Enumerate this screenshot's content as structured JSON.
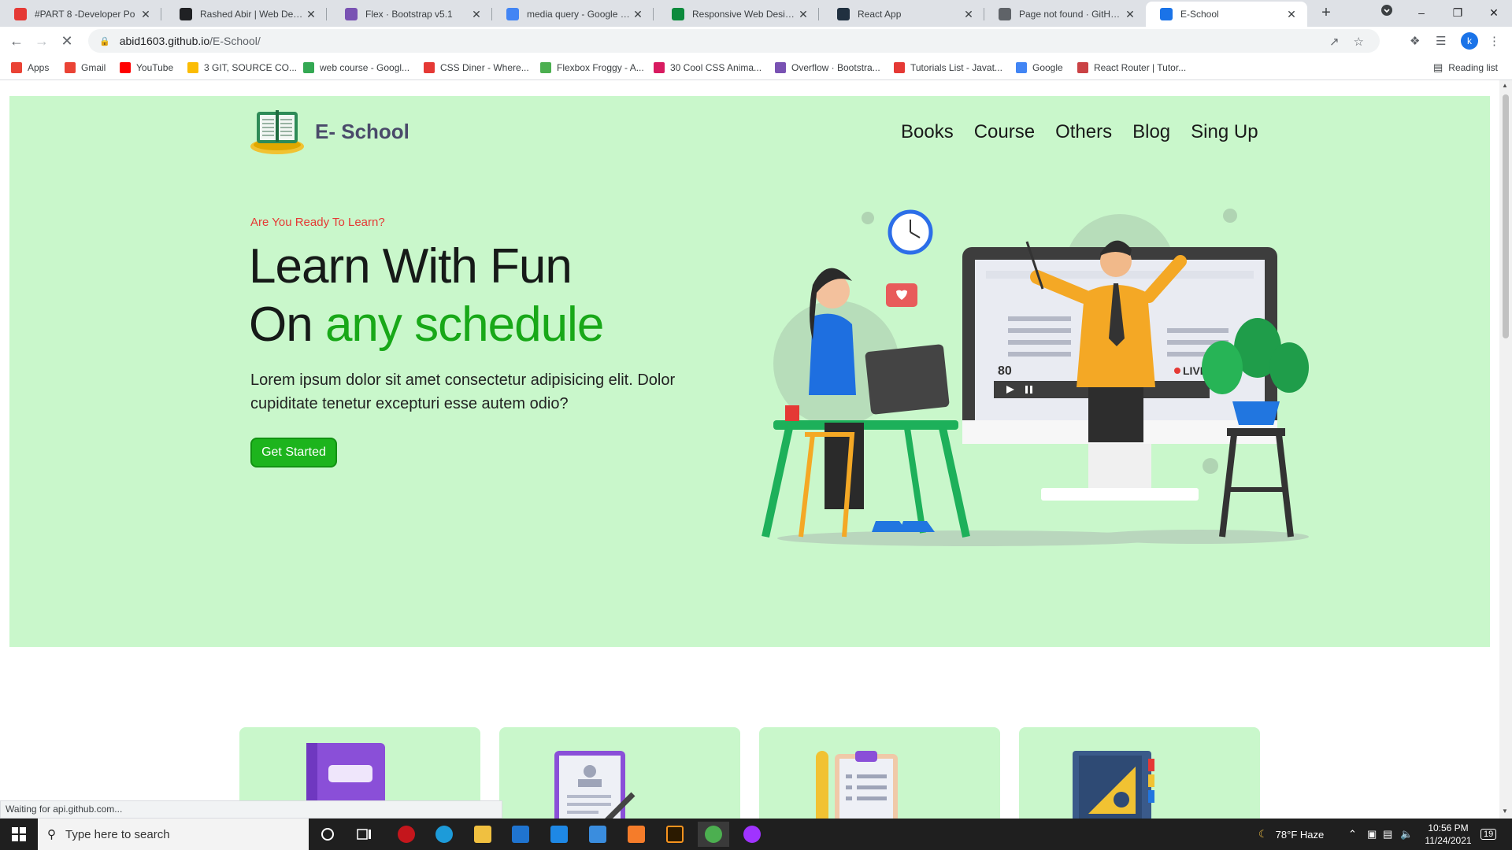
{
  "browser": {
    "tabs": [
      {
        "title": "#PART 8 -Developer Po",
        "icon": "youtube-icon",
        "color": "#e53935"
      },
      {
        "title": "Rashed Abir | Web Develop",
        "icon": "site-icon",
        "color": "#202124"
      },
      {
        "title": "Flex · Bootstrap v5.1",
        "icon": "bootstrap-icon",
        "color": "#7952b3"
      },
      {
        "title": "media query - Google Sear",
        "icon": "google-icon",
        "color": "#4285f4"
      },
      {
        "title": "Responsive Web Design M",
        "icon": "w-icon",
        "color": "#0c8a3c"
      },
      {
        "title": "React App",
        "icon": "react-icon",
        "color": "#203040"
      },
      {
        "title": "Page not found · GitHub P",
        "icon": "globe-icon",
        "color": "#5f6368"
      },
      {
        "title": "E-School",
        "icon": "loading-icon",
        "color": "#1a73e8"
      }
    ],
    "new_tab": "+",
    "url_host": "abid1603.github.io",
    "url_path": "/E-School/",
    "bookmarks": [
      {
        "label": "Apps",
        "color": "#ea4335"
      },
      {
        "label": "Gmail",
        "color": "#ea4335"
      },
      {
        "label": "YouTube",
        "color": "#ff0000"
      },
      {
        "label": "3 GIT, SOURCE CO...",
        "color": "#fbbc04"
      },
      {
        "label": "web course - Googl...",
        "color": "#34a853"
      },
      {
        "label": "CSS Diner - Where...",
        "color": "#e53935"
      },
      {
        "label": "Flexbox Froggy - A...",
        "color": "#4caf50"
      },
      {
        "label": "30 Cool CSS Anima...",
        "color": "#d81b60"
      },
      {
        "label": "Overflow · Bootstra...",
        "color": "#7952b3"
      },
      {
        "label": "Tutorials List - Javat...",
        "color": "#e53935"
      },
      {
        "label": "Google",
        "color": "#4285f4"
      },
      {
        "label": "React Router | Tutor...",
        "color": "#ca4245"
      }
    ],
    "reading_list": "Reading list",
    "avatar_letter": "k",
    "status": "Waiting for api.github.com..."
  },
  "page": {
    "brand": "E- School",
    "nav": [
      "Books",
      "Course",
      "Others",
      "Blog",
      "Sing Up"
    ],
    "eyebrow": "Are You Ready To Learn?",
    "headline_line1": "Learn With Fun",
    "headline_line2_prefix": "On ",
    "headline_line2_highlight": "any schedule",
    "lede": "Lorem ipsum dolor sit amet consectetur adipisicing elit. Dolor cupiditate tenetur excepturi esse autem odio?",
    "cta": "Get Started",
    "illustration": {
      "viewer_count": "80",
      "live_label": "LIVE"
    },
    "colors": {
      "hero_bg": "#c9f7cb",
      "accent_green": "#18a818",
      "eyebrow_red": "#e53935",
      "button_green": "#1db41d"
    }
  },
  "taskbar": {
    "search_placeholder": "Type here to search",
    "weather": "78°F  Haze",
    "time": "10:56 PM",
    "date": "11/24/2021",
    "notifications": "19"
  }
}
